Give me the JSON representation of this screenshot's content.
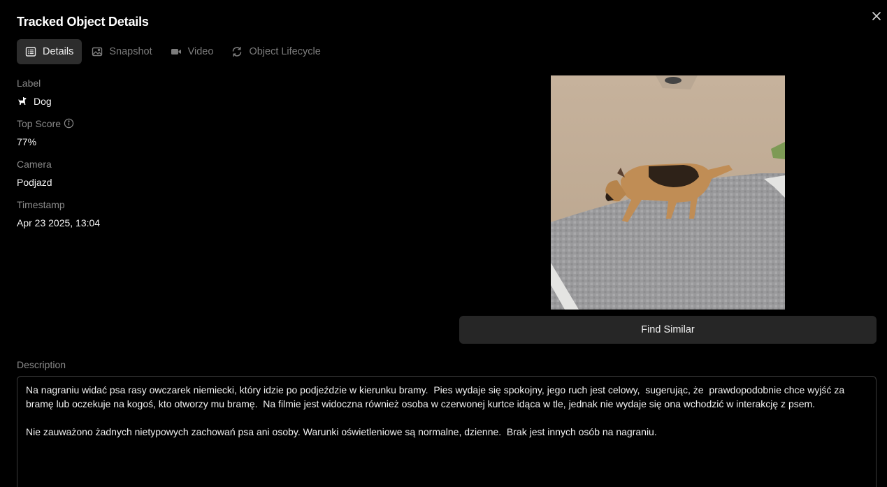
{
  "dialog": {
    "title": "Tracked Object Details",
    "close_icon": "close-icon"
  },
  "tabs": [
    {
      "label": "Details",
      "icon": "list-icon",
      "active": true
    },
    {
      "label": "Snapshot",
      "icon": "image-icon",
      "active": false
    },
    {
      "label": "Video",
      "icon": "video-icon",
      "active": false
    },
    {
      "label": "Object Lifecycle",
      "icon": "refresh-icon",
      "active": false
    }
  ],
  "details": {
    "label_title": "Label",
    "label_value": "Dog",
    "label_icon": "dog-icon",
    "score_title": "Top Score",
    "score_value": "77%",
    "camera_title": "Camera",
    "camera_value": "Podjazd",
    "timestamp_title": "Timestamp",
    "timestamp_value": "Apr 23 2025, 13:04"
  },
  "snapshot": {
    "find_similar_label": "Find Similar"
  },
  "description": {
    "title": "Description",
    "paragraph_1": "Na nagraniu widać psa rasy owczarek niemiecki, który idzie po podjeździe w kierunku bramy.  Pies wydaje się spokojny, jego ruch jest celowy,  sugerując, że  prawdopodobnie chce wyjść za bramę lub oczekuje na kogoś, kto otworzy mu bramę.  Na filmie jest widoczna również osoba w czerwonej kurtce idąca w tle, jednak nie wydaje się ona wchodzić w interakcję z psem.",
    "paragraph_2": "Nie zauważono żadnych nietypowych zachowań psa ani osoby. Warunki oświetleniowe są normalne, dzienne.  Brak jest innych osób na nagraniu."
  },
  "colors": {
    "background": "#000000",
    "active_tab_bg": "#2d2d2d",
    "button_bg": "#262626",
    "muted_text": "#8a8a8a"
  }
}
